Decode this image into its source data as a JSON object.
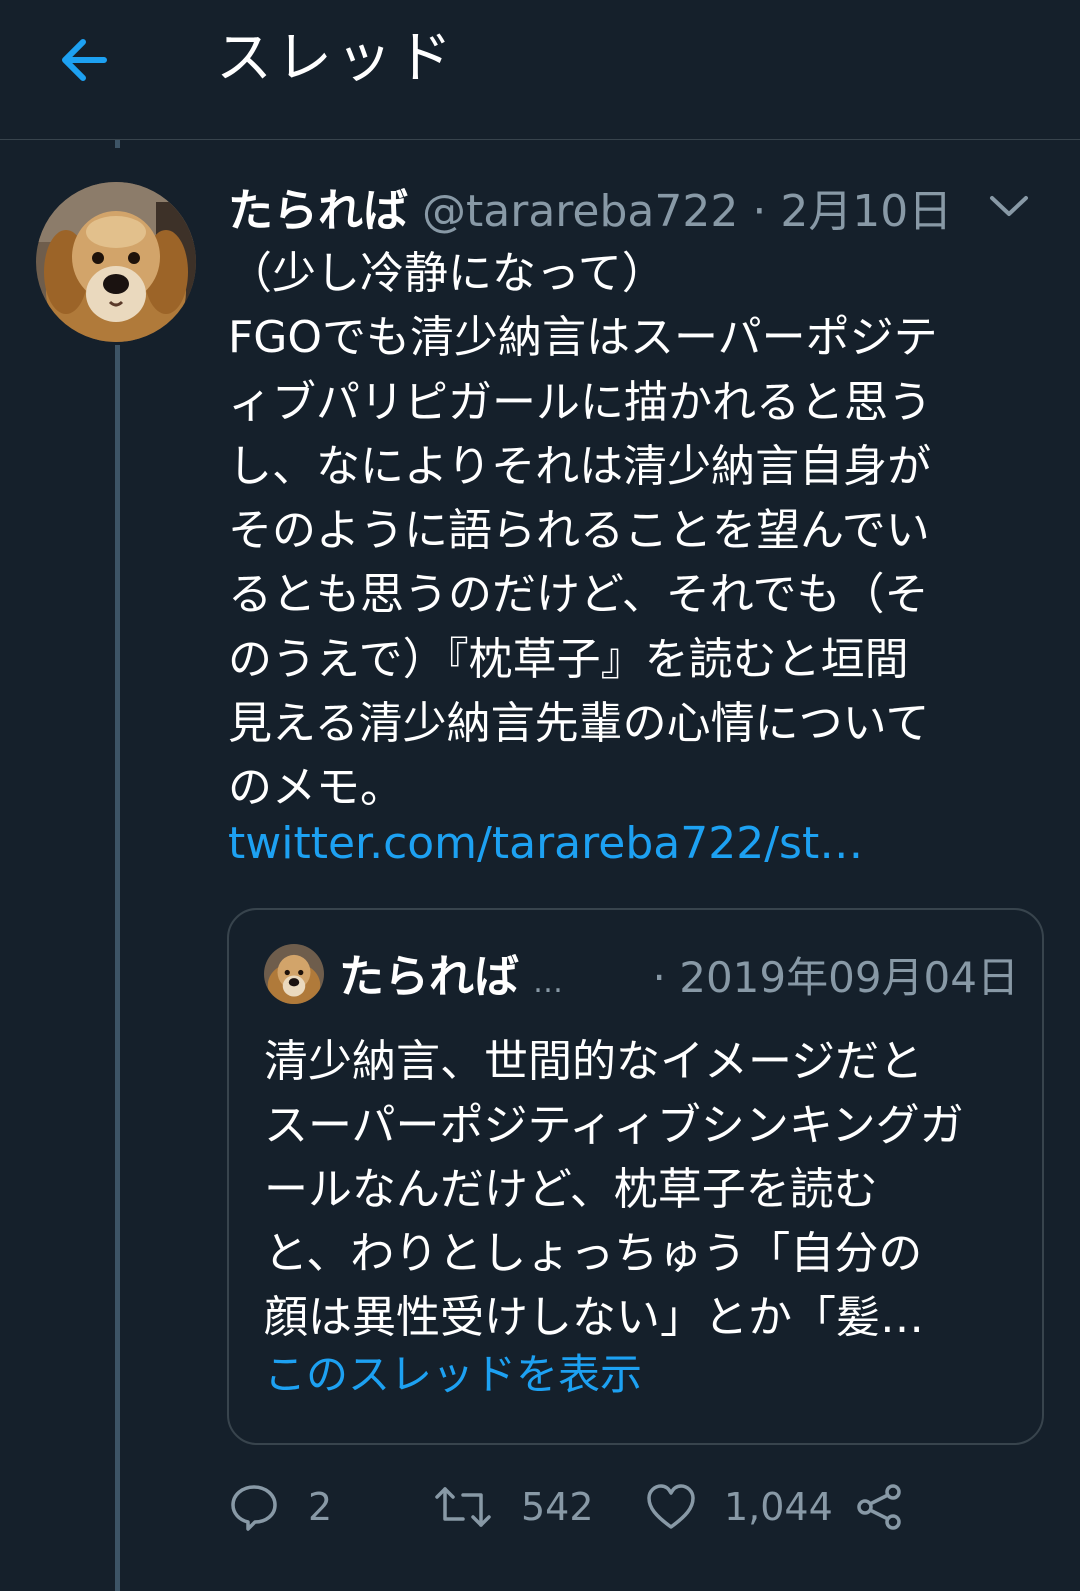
{
  "header": {
    "title": "スレッド",
    "back_icon": "arrow-left-icon",
    "accent_color": "#1da1f2"
  },
  "tweet": {
    "name": "たられば",
    "handle": "@tarareba722",
    "separator_date": " · 2月10日",
    "text": "（少し冷静になって）\nFGOでも清少納言はスーパーポジティィブパリピガールに描かれると思うし、なによりそれは清少納言自身がそのように語られることを望んでいるとも思うのだけど、それでも（そのうえで）『枕草子』を読むと垣間見える清少納言先輩の心情についてのメモ。",
    "link": "twitter.com/tarareba722/st…",
    "quote": {
      "name": "たられば",
      "ellipsis": "…",
      "date": "· 2019年09月04日",
      "text": "清少納言、世間的なイメージだとスーパーポジティィブシンキングガールなんだけど、枕草子を読むと、わりとしょっちゅう「自分の顔は異性受けしない」とか「髪…",
      "show_thread": "このスレッドを表示"
    },
    "actions": {
      "reply_count": "2",
      "retweet_count": "542",
      "like_count": "1,044"
    }
  }
}
